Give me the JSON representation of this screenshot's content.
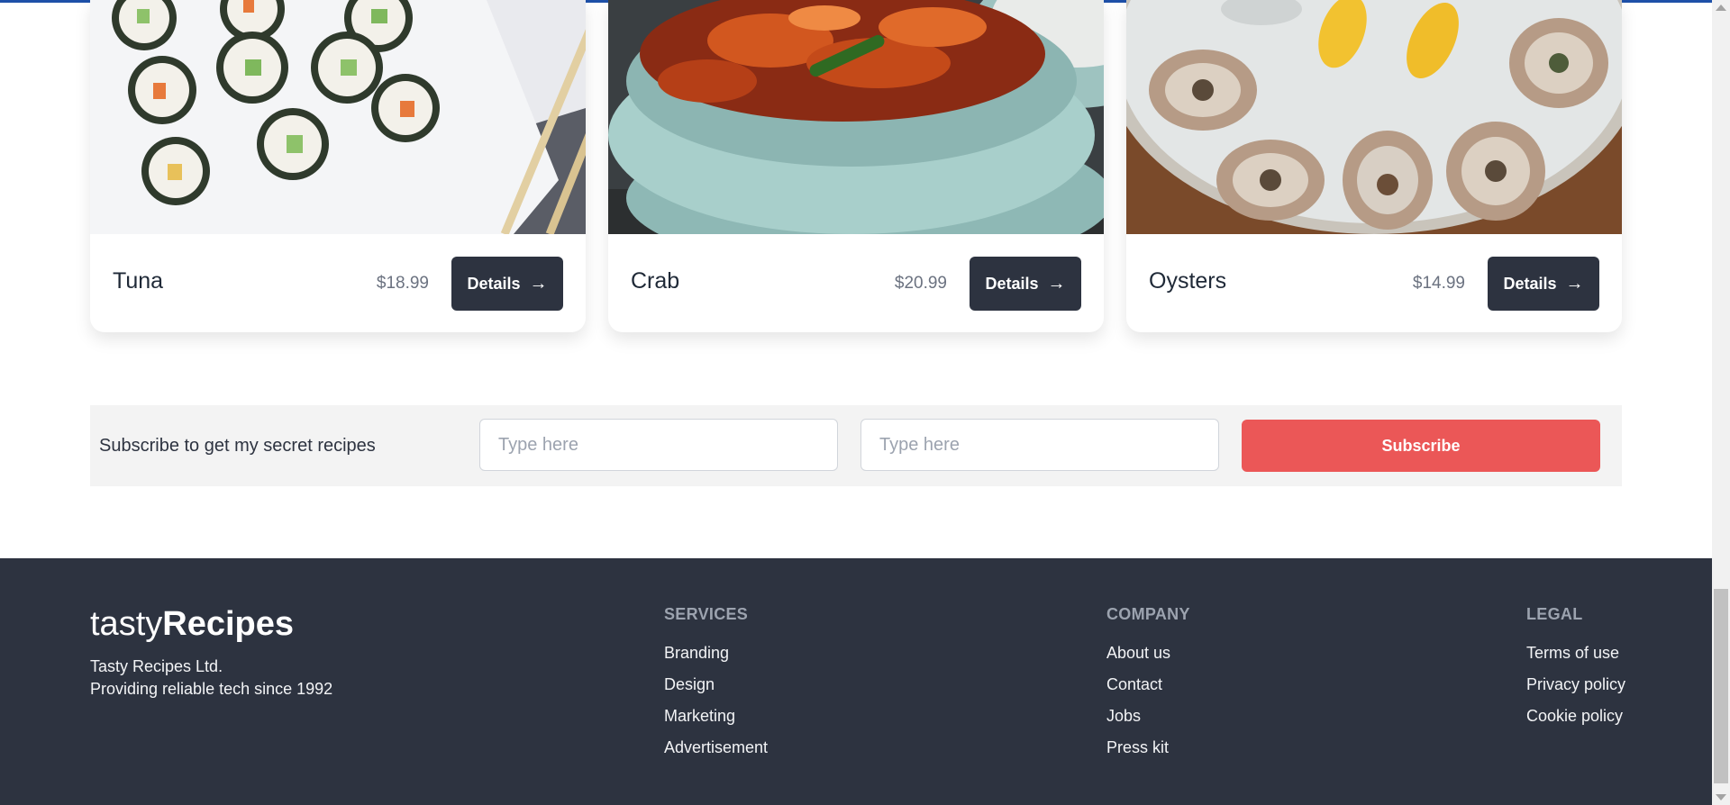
{
  "cards": [
    {
      "name": "Tuna",
      "price": "$18.99",
      "button_label": "Details",
      "image": "sushi-rolls-photo"
    },
    {
      "name": "Crab",
      "price": "$20.99",
      "button_label": "Details",
      "image": "crab-bowl-photo"
    },
    {
      "name": "Oysters",
      "price": "$14.99",
      "button_label": "Details",
      "image": "oysters-on-ice-photo"
    }
  ],
  "subscribe": {
    "text": "Subscribe to get my secret recipes",
    "input1_placeholder": "Type here",
    "input2_placeholder": "Type here",
    "button_label": "Subscribe"
  },
  "footer": {
    "brand_light": "tasty",
    "brand_bold": "Recipes",
    "company_name": "Tasty Recipes Ltd.",
    "tagline": "Providing reliable tech since 1992",
    "columns": [
      {
        "title": "SERVICES",
        "links": [
          "Branding",
          "Design",
          "Marketing",
          "Advertisement"
        ]
      },
      {
        "title": "COMPANY",
        "links": [
          "About us",
          "Contact",
          "Jobs",
          "Press kit"
        ]
      },
      {
        "title": "LEGAL",
        "links": [
          "Terms of use",
          "Privacy policy",
          "Cookie policy"
        ]
      }
    ]
  },
  "colors": {
    "footer_bg": "#2d3340",
    "button_dark": "#2d3340",
    "subscribe_button": "#eb5757",
    "subscribe_bg": "#f3f3f3"
  }
}
